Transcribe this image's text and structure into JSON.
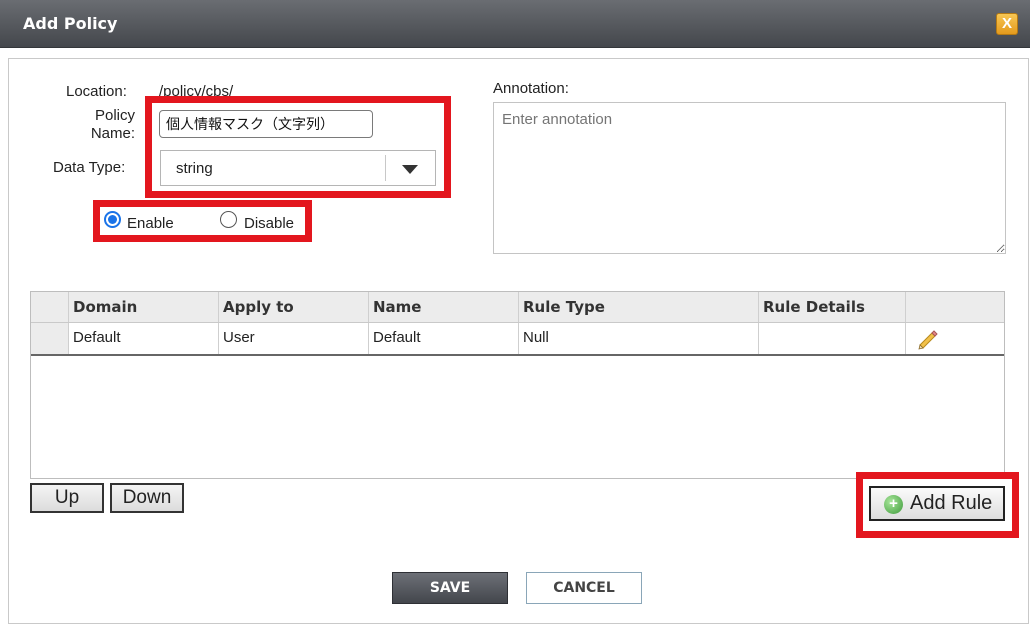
{
  "dialog": {
    "title": "Add Policy",
    "close_label": "X"
  },
  "form": {
    "location_label": "Location:",
    "location_value": "/policy/cbs/",
    "policy_name_label_line1": "Policy",
    "policy_name_label_line2": "Name:",
    "policy_name_value": "個人情報マスク（文字列）",
    "data_type_label": "Data Type:",
    "data_type_value": "string",
    "enable_label": "Enable",
    "disable_label": "Disable",
    "status_selected": "Enable",
    "annotation_label": "Annotation:",
    "annotation_placeholder": "Enter annotation"
  },
  "rules_table": {
    "columns": [
      "Domain",
      "Apply to",
      "Name",
      "Rule Type",
      "Rule Details"
    ],
    "rows": [
      {
        "domain": "Default",
        "apply_to": "User",
        "name": "Default",
        "rule_type": "Null",
        "rule_details": "",
        "action_icon": "pencil-edit-icon"
      }
    ]
  },
  "buttons": {
    "up": "Up",
    "down": "Down",
    "add_rule": "Add Rule",
    "save": "SAVE",
    "cancel": "CANCEL"
  },
  "highlight_color": "#e3161e",
  "accent_color": "#1a73e8"
}
